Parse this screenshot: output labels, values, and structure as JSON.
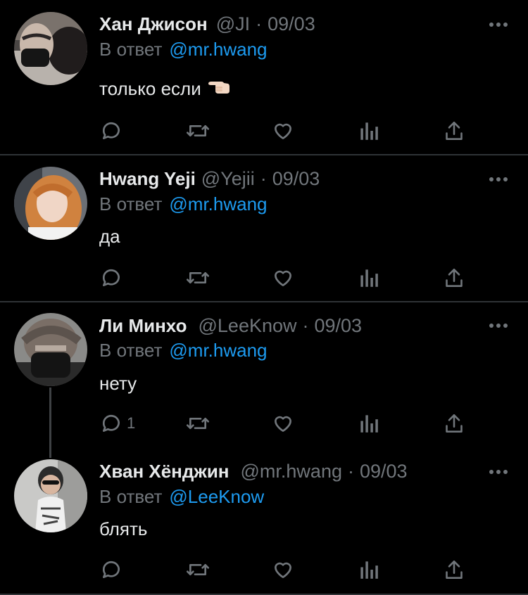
{
  "tweets": [
    {
      "name": "Хан Джисон",
      "handle": "@JI",
      "date": "09/03",
      "reply_prefix": "В ответ",
      "reply_to": "@mr.hwang",
      "text": "только если",
      "emoji": "hand-pointing-left-icon",
      "reply_count": ""
    },
    {
      "name": "Hwang Yeji",
      "handle": "@Yejii",
      "date": "09/03",
      "reply_prefix": "В ответ",
      "reply_to": "@mr.hwang",
      "text": "да",
      "reply_count": ""
    },
    {
      "name": "Ли Минхо",
      "handle": "@LeeKnow",
      "date": "09/03",
      "reply_prefix": "В ответ",
      "reply_to": "@mr.hwang",
      "text": "нету",
      "reply_count": "1"
    },
    {
      "name": "Хван Хёнджин",
      "handle": "@mr.hwang",
      "date": "09/03",
      "reply_prefix": "В ответ",
      "reply_to": "@LeeKnow",
      "text": "блять",
      "reply_count": ""
    }
  ],
  "separator": "·",
  "colors": {
    "background": "#000000",
    "primary_text": "#e7e9ea",
    "secondary_text": "#71767b",
    "link": "#1d9bf0",
    "divider": "#2f3336"
  },
  "icons": [
    "reply-icon",
    "retweet-icon",
    "like-icon",
    "analytics-icon",
    "share-icon",
    "more-icon"
  ]
}
